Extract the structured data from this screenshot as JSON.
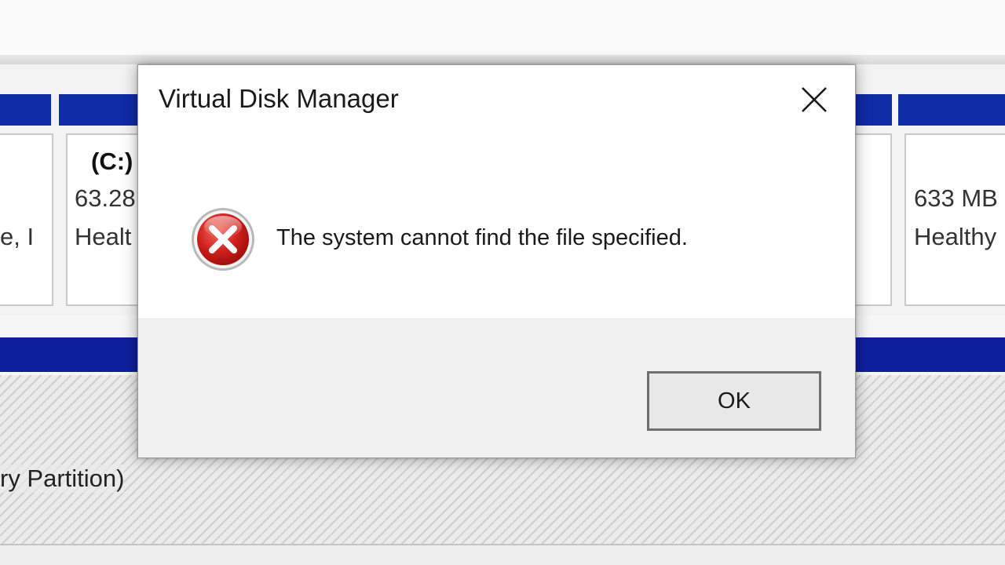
{
  "dialog": {
    "title": "Virtual Disk Manager",
    "message": "The system cannot find the file specified.",
    "ok_label": "OK",
    "icon": "error-icon",
    "close_icon": "close-icon"
  },
  "background": {
    "volumes": [
      {
        "name": "",
        "size": "",
        "status": "e, I"
      },
      {
        "name": "(C:)",
        "size": "63.28",
        "status": "Healt"
      },
      {
        "name": "",
        "size": "633 MB",
        "status": "Healthy"
      }
    ],
    "partition_label": "ry Partition)"
  },
  "colors": {
    "volume_bar": "#0f2ba6",
    "error_red": "#d0201c",
    "dialog_footer": "#f0f0f0"
  }
}
